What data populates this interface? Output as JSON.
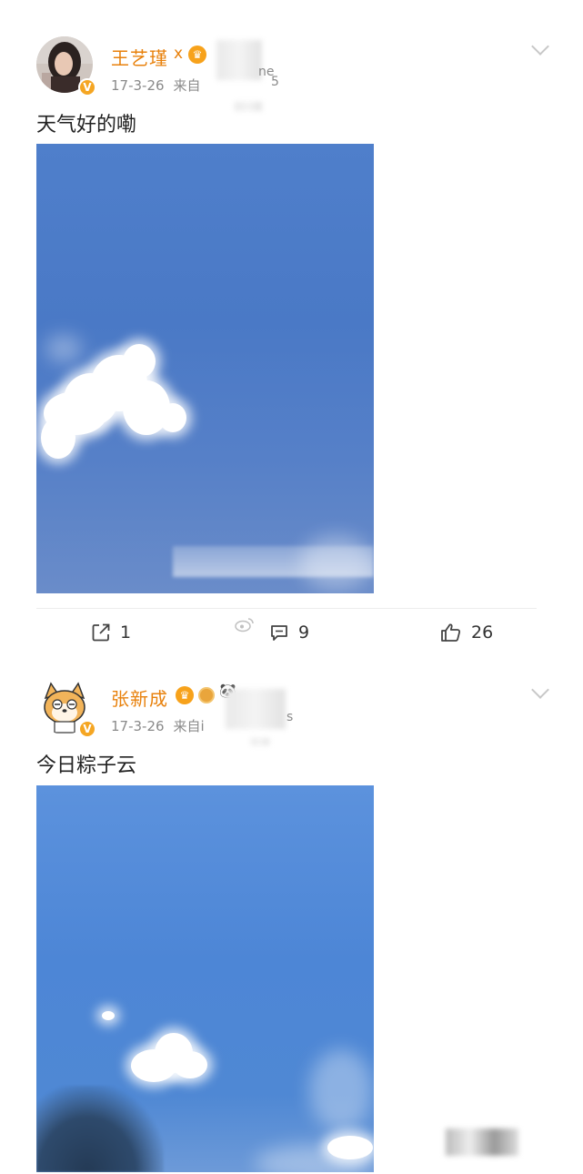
{
  "posts": [
    {
      "user": {
        "name": "王艺瑾",
        "name_suffix": "x",
        "verified_mark": "V"
      },
      "meta": {
        "date": "17-3-26",
        "source_prefix": "来自",
        "source_fragment": "ne",
        "source_fragment_2": "5"
      },
      "text": "天气好的嘞",
      "image": {
        "subject": "blue sky with a white cloud"
      },
      "actions": {
        "repost_count": "1",
        "comment_count": "9",
        "like_count": "26"
      }
    },
    {
      "user": {
        "name": "张新成",
        "verified_mark": "V"
      },
      "meta": {
        "date": "17-3-26",
        "source_prefix": "来自i",
        "source_fragment": "s"
      },
      "text": "今日粽子云",
      "image": {
        "subject": "blue sky with a small white cloud"
      }
    }
  ],
  "icons": {
    "repost": "repost-icon",
    "comment": "comment-icon",
    "like": "thumbs-up-icon",
    "more": "chevron-down-icon"
  },
  "colors": {
    "username": "#e8810c",
    "meta": "#8a8a8a",
    "verified_badge": "#f5a623"
  }
}
